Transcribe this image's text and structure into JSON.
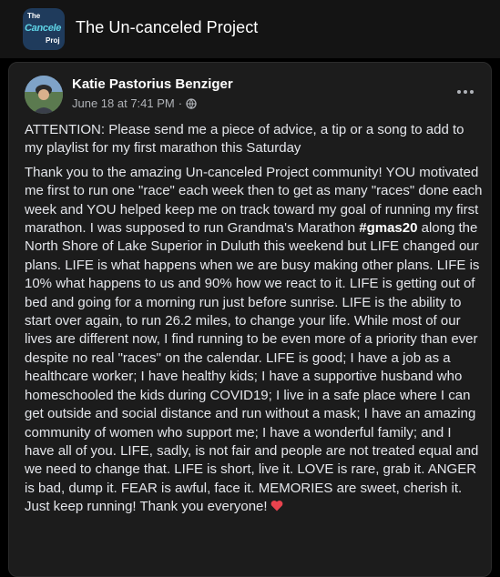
{
  "group": {
    "logo_the": "The",
    "logo_main": "Cancele",
    "logo_sub": "Proj",
    "name": "The Un-canceled Project"
  },
  "post": {
    "author": "Katie Pastorius Benziger",
    "date": "June 18 at 7:41 PM",
    "separator": "·",
    "privacy_icon": "globe-icon",
    "more_icon": "more-options-icon",
    "attention": "ATTENTION: Please send me a piece of advice, a tip or a song to add to my playlist for my first marathon this Saturday",
    "body_before_hashtag": "Thank you to the amazing Un-canceled Project community! YOU motivated me first to run one \"race\" each week then to get as many \"races\" done each week and YOU helped keep me on track toward my goal of running my first marathon. I was supposed to run Grandma's Marathon ",
    "hashtag": "#gmas20",
    "body_after_hashtag": " along the North Shore of Lake Superior in Duluth this weekend but LIFE changed our plans. LIFE is what happens when we are busy making other plans. LIFE is 10% what happens to us and 90% how we react to it. LIFE is getting out of bed and going for a morning run just before sunrise. LIFE is the ability to start over again, to run 26.2 miles, to change your life. While most of our lives are different now, I find running to be even more of a priority than ever despite no real \"races\" on the calendar. LIFE is good; I have a job as a healthcare worker; I have healthy kids; I have a supportive husband who homeschooled the kids during COVID19; I live in a safe place where I can get outside and social distance and run without a mask; I have an amazing community of women who support me; I have a wonderful family; and I have all of you. LIFE, sadly, is not fair and people are not treated equal and we need to change that. LIFE is short, live it. LOVE is rare, grab it. ANGER is bad, dump it. FEAR is awful, face it. MEMORIES are sweet, cherish it. Just keep running! Thank you everyone!",
    "end_emoji": "heart-icon"
  },
  "colors": {
    "background": "#000000",
    "card": "#1c1c1c",
    "text": "#e4e6eb",
    "secondary_text": "#b0b3b8",
    "heart": "#e8434e"
  }
}
